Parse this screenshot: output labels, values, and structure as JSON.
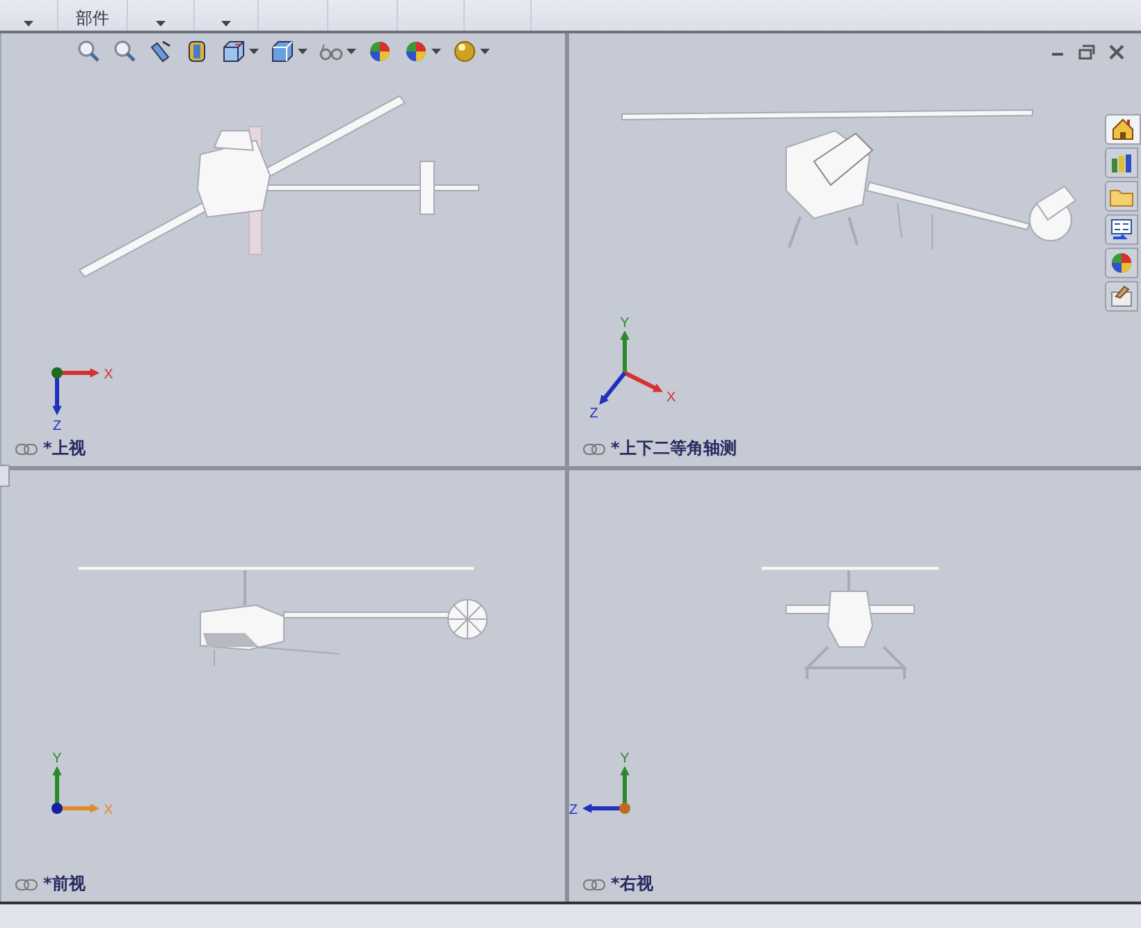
{
  "ribbon": {
    "items": [
      {
        "dropdown": true
      },
      {
        "label": "部件",
        "dropdown": false
      },
      {
        "dropdown": true
      },
      {
        "dropdown": true
      }
    ]
  },
  "view_toolbar": [
    {
      "kind": "zoom-fit",
      "dropdown": false
    },
    {
      "kind": "zoom-area",
      "dropdown": false
    },
    {
      "kind": "previous-view",
      "dropdown": false
    },
    {
      "kind": "section",
      "dropdown": false
    },
    {
      "kind": "orientation",
      "dropdown": true
    },
    {
      "kind": "display-style",
      "dropdown": true
    },
    {
      "kind": "hide-show",
      "dropdown": true
    },
    {
      "kind": "appearance",
      "dropdown": false
    },
    {
      "kind": "scene",
      "dropdown": true
    },
    {
      "kind": "lights",
      "dropdown": true
    }
  ],
  "viewports": [
    {
      "label": "*上视",
      "triad": {
        "axes": [
          {
            "label": "X",
            "color": "#d83030"
          },
          {
            "label": "Z",
            "color": "#2030c0"
          }
        ]
      }
    },
    {
      "label": "*上下二等角轴测",
      "triad": {
        "axes": [
          {
            "label": "Y",
            "color": "#2a8a2a"
          },
          {
            "label": "X",
            "color": "#d83030"
          },
          {
            "label": "Z",
            "color": "#2030c0"
          }
        ]
      }
    },
    {
      "label": "*前视",
      "triad": {
        "axes": [
          {
            "label": "Y",
            "color": "#2a8a2a"
          },
          {
            "label": "X",
            "color": "#e08a30"
          }
        ]
      }
    },
    {
      "label": "*右视",
      "triad": {
        "axes": [
          {
            "label": "Y",
            "color": "#2a8a2a"
          },
          {
            "label": "Z",
            "color": "#2030c0"
          }
        ]
      }
    }
  ],
  "task_pane_tabs": [
    {
      "kind": "home",
      "selected": true
    },
    {
      "kind": "library",
      "selected": false
    },
    {
      "kind": "folder",
      "selected": false
    },
    {
      "kind": "palette",
      "selected": false
    },
    {
      "kind": "appearances",
      "selected": false
    },
    {
      "kind": "properties",
      "selected": false
    }
  ]
}
